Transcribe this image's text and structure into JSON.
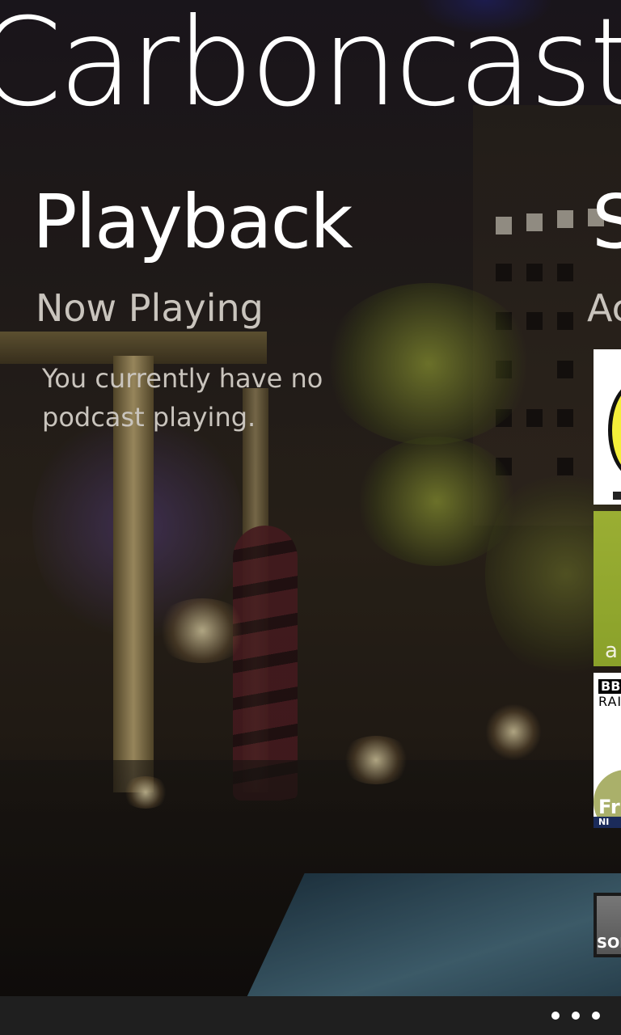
{
  "app": {
    "title": "Carboncast"
  },
  "pivot": {
    "current": "Playback",
    "next_partial": "S"
  },
  "playback": {
    "section_title": "Now Playing",
    "empty_message": "You currently have no podcast playing."
  },
  "subscriptions_peek": {
    "section_partial": "Ac",
    "tiles": [
      {
        "icon": "podcast-art-yellow-circle",
        "text": ""
      },
      {
        "icon": "podcast-art-green",
        "text": "a"
      },
      {
        "icon": "podcast-art-bbc-radio",
        "brand": "BBC",
        "label": "RAI",
        "subtitle": "Fri",
        "strip": "NI"
      },
      {
        "icon": "podcast-art-grey",
        "text": "SOM"
      }
    ]
  },
  "app_bar": {
    "more_icon": "ellipsis-icon"
  },
  "colors": {
    "text_primary": "#ffffff",
    "text_secondary": "#c9c4bd",
    "app_bar": "#1f1f1f"
  }
}
